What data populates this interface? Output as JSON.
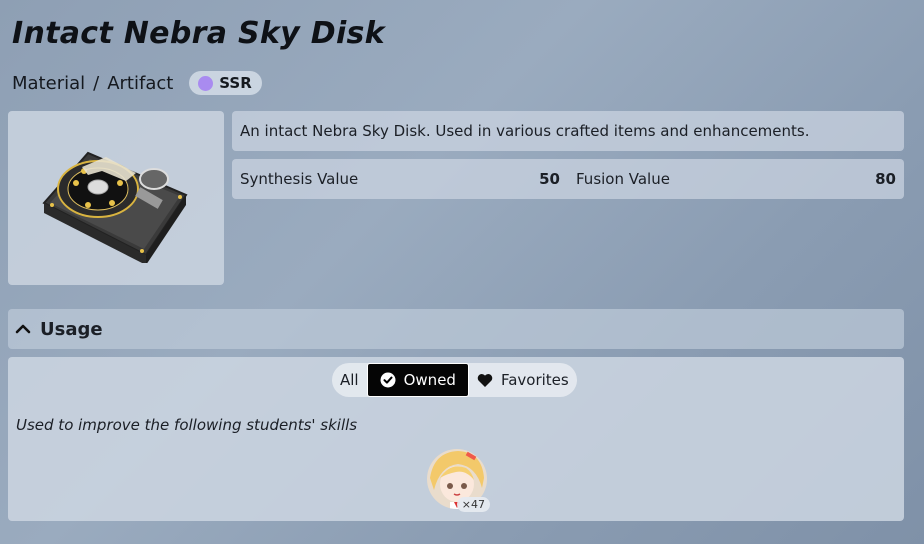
{
  "item": {
    "name": "Intact Nebra Sky Disk",
    "category": "Material",
    "separator": "/",
    "subcategory": "Artifact",
    "rarity": "SSR",
    "rarity_color": "#a98bf0",
    "description": "An intact Nebra Sky Disk. Used in various crafted items and enhancements.",
    "icon": "hard-drive-icon"
  },
  "stats": [
    {
      "label": "Synthesis Value",
      "value": "50"
    },
    {
      "label": "Fusion Value",
      "value": "80"
    }
  ],
  "usage": {
    "title": "Usage",
    "filters": [
      {
        "label": "All",
        "icon": ""
      },
      {
        "label": "Owned",
        "icon": "check-circle-icon",
        "active": true
      },
      {
        "label": "Favorites",
        "icon": "heart-icon"
      }
    ],
    "hint": "Used to improve the following students' skills",
    "students": [
      {
        "count": "×47"
      }
    ]
  }
}
